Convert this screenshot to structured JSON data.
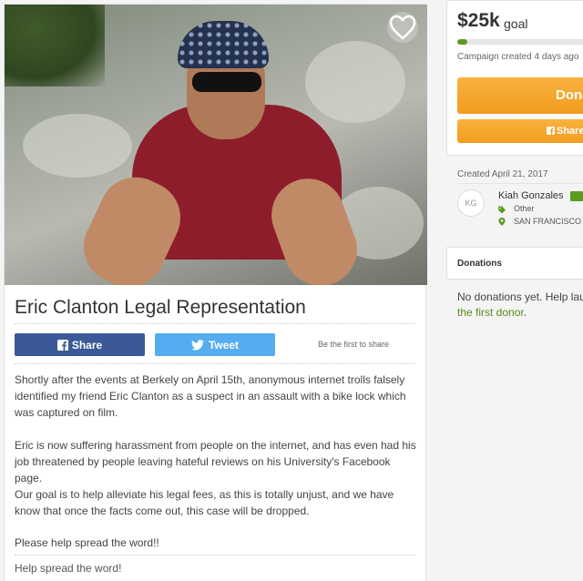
{
  "campaign": {
    "title": "Eric Clanton Legal Representation",
    "description": [
      "Shortly after the events at Berkely on April 15th, anonymous internet trolls falsely identified my friend Eric Clanton as a suspect in an assault with a bike lock which was captured on film.",
      "Eric is now suffering harassment from people on the internet, and has even had his job threatened by people leaving hateful reviews on his University's Facebook page.",
      "Our goal is to help alleviate his legal fees, as this is totally unjust, and we have know that once the facts come out, this case will be dropped.",
      "Please help spread the word!!"
    ],
    "help_link": "Help spread the word!"
  },
  "share": {
    "facebook_label": "Share",
    "twitter_label": "Tweet",
    "first_to_share": "Be the first to share"
  },
  "goal": {
    "amount": "$25k",
    "label": "goal",
    "progress_fraction": 0.07,
    "created_ago": "Campaign created 4 days ago",
    "donate_label": "Dona",
    "share_label": "Share"
  },
  "organizer": {
    "created_date": "Created April 21, 2017",
    "initials": "KG",
    "name": "Kiah Gonzales",
    "category": "Other",
    "location": "SAN FRANCISCO"
  },
  "donations": {
    "title": "Donations",
    "empty_text": "No donations yet. Help laun",
    "first_donor_link": "the first donor",
    "after_link": "."
  },
  "colors": {
    "facebook": "#3b5998",
    "twitter": "#55acee",
    "donate_orange": "#f29c1f",
    "accent_green": "#5b9b1f"
  },
  "icons": {
    "heart": "heart-icon",
    "facebook": "facebook-icon",
    "twitter": "twitter-icon",
    "verified": "verified-icon",
    "tag": "tag-icon",
    "location": "map-pin-icon"
  }
}
